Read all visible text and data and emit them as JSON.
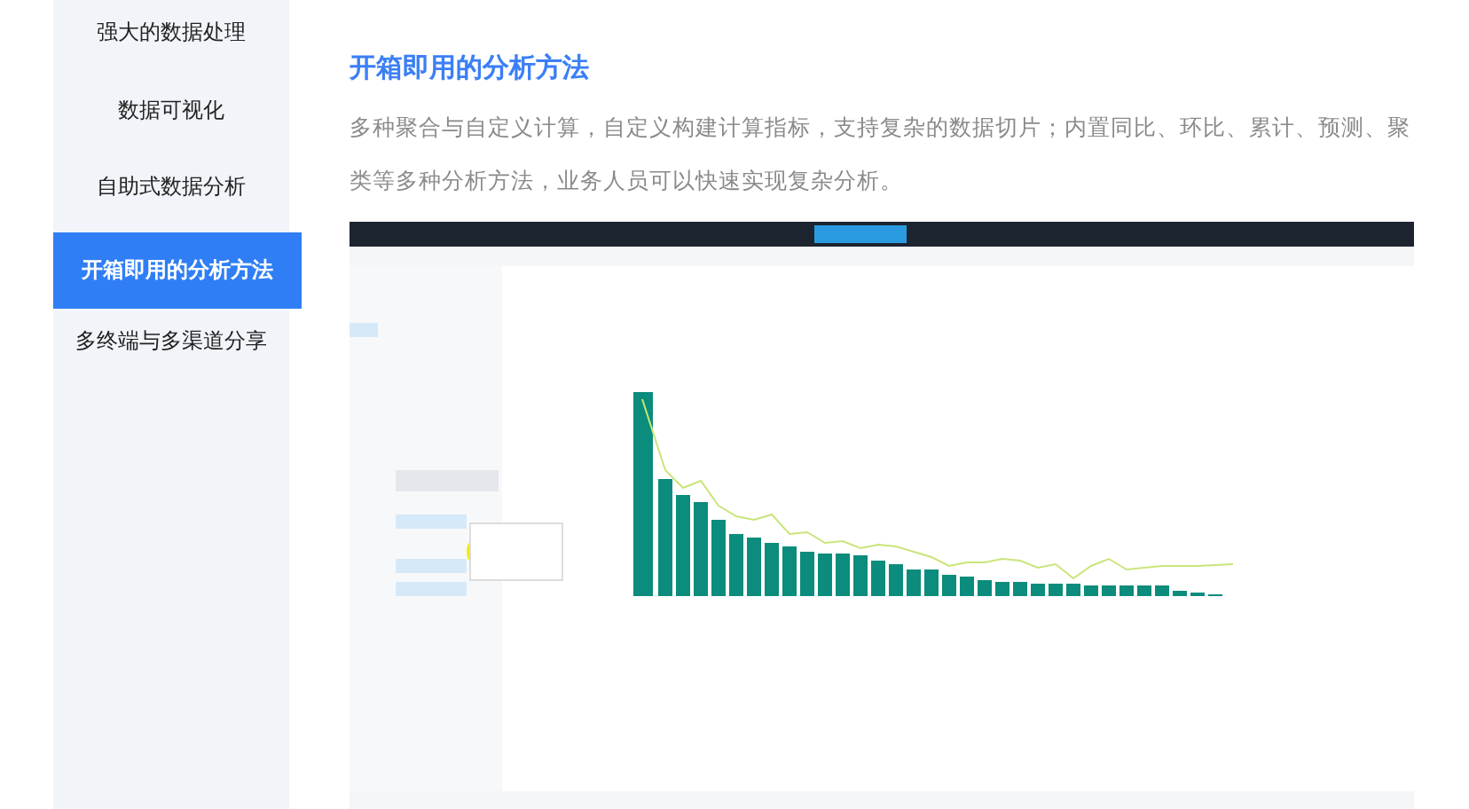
{
  "sidebar": {
    "items": [
      {
        "label": "强大的数据处理",
        "selected": false
      },
      {
        "label": "数据可视化",
        "selected": false
      },
      {
        "label": "自助式数据分析",
        "selected": false
      },
      {
        "label": "开箱即用的分析方法",
        "selected": true
      },
      {
        "label": "多终端与多渠道分享",
        "selected": false
      }
    ]
  },
  "content": {
    "title": "开箱即用的分析方法",
    "description": "多种聚合与自定义计算，自定义构建计算指标，支持复杂的数据切片；内置同比、环比、累计、预测、聚类等多种分析方法，业务人员可以快速实现复杂分析。"
  }
}
